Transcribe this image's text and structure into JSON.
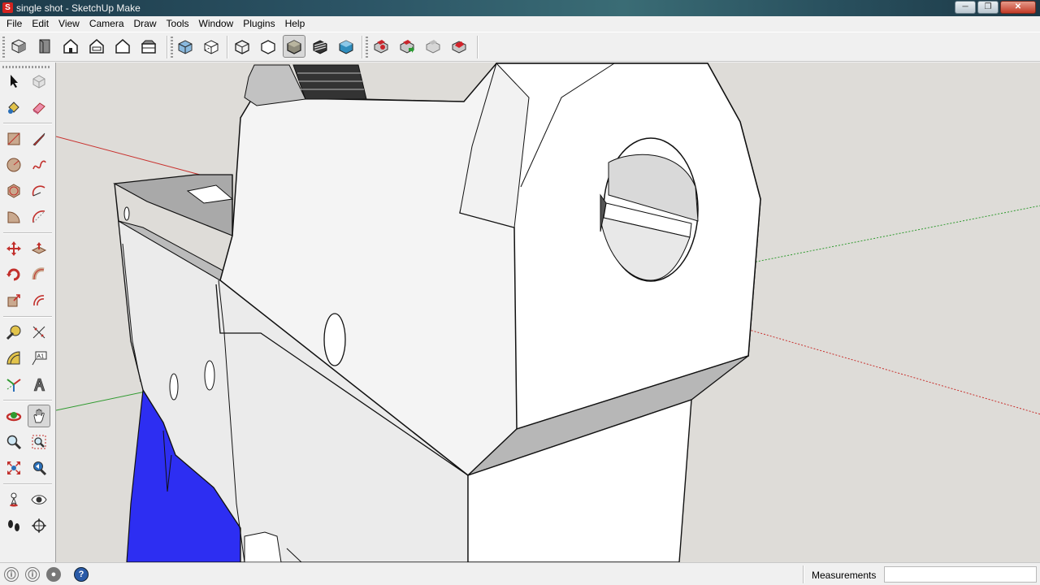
{
  "window": {
    "title": "single shot - SketchUp Make",
    "app_icon_letter": "S",
    "minimize_glyph": "─",
    "maximize_glyph": "❐",
    "close_glyph": "✕"
  },
  "menu": [
    "File",
    "Edit",
    "View",
    "Camera",
    "Draw",
    "Tools",
    "Window",
    "Plugins",
    "Help"
  ],
  "toolbar": {
    "view_icons": [
      "iso-view-icon",
      "top-view-icon",
      "front-view-icon",
      "right-view-icon",
      "back-view-icon",
      "left-view-icon"
    ],
    "style_icons": [
      "xray-icon",
      "back-edges-icon",
      "wireframe-icon",
      "hidden-line-icon",
      "shaded-icon",
      "shaded-textures-icon",
      "monochrome-icon"
    ],
    "active_style": "shaded-icon",
    "warehouse_icons": [
      "get-models-icon",
      "share-model-icon",
      "share-component-icon",
      "extension-warehouse-icon"
    ]
  },
  "tools": [
    [
      "select-icon",
      "make-component-icon"
    ],
    [
      "paint-bucket-icon",
      "eraser-icon"
    ],
    [
      "rectangle-icon",
      "line-icon"
    ],
    [
      "circle-icon",
      "freehand-icon"
    ],
    [
      "polygon-icon",
      "arc-icon"
    ],
    [
      "pie-icon",
      "two-point-arc-icon"
    ],
    [
      "move-icon",
      "push-pull-icon"
    ],
    [
      "rotate-icon",
      "follow-me-icon"
    ],
    [
      "scale-icon",
      "offset-icon"
    ],
    [
      "tape-measure-icon",
      "dimension-icon"
    ],
    [
      "protractor-icon",
      "text-icon"
    ],
    [
      "axes-icon",
      "3d-text-icon"
    ],
    [
      "orbit-icon",
      "pan-icon"
    ],
    [
      "zoom-icon",
      "zoom-window-icon"
    ],
    [
      "zoom-extents-icon",
      "previous-view-icon"
    ],
    [
      "position-camera-icon",
      "look-around-icon"
    ],
    [
      "walk-icon",
      "section-plane-icon"
    ]
  ],
  "active_tool": "pan-icon",
  "text_tool_label": "A1",
  "status": {
    "help_glyph": "?",
    "measurements_label": "Measurements",
    "measurements_value": ""
  },
  "colors": {
    "viewport_bg": "#dedcd8",
    "axis_red": "#c8312e",
    "axis_green": "#2f9a2f",
    "model_face": "#f7f7f7",
    "model_shadow": "#b9b9b9",
    "blue_part": "#2d2ef2"
  }
}
